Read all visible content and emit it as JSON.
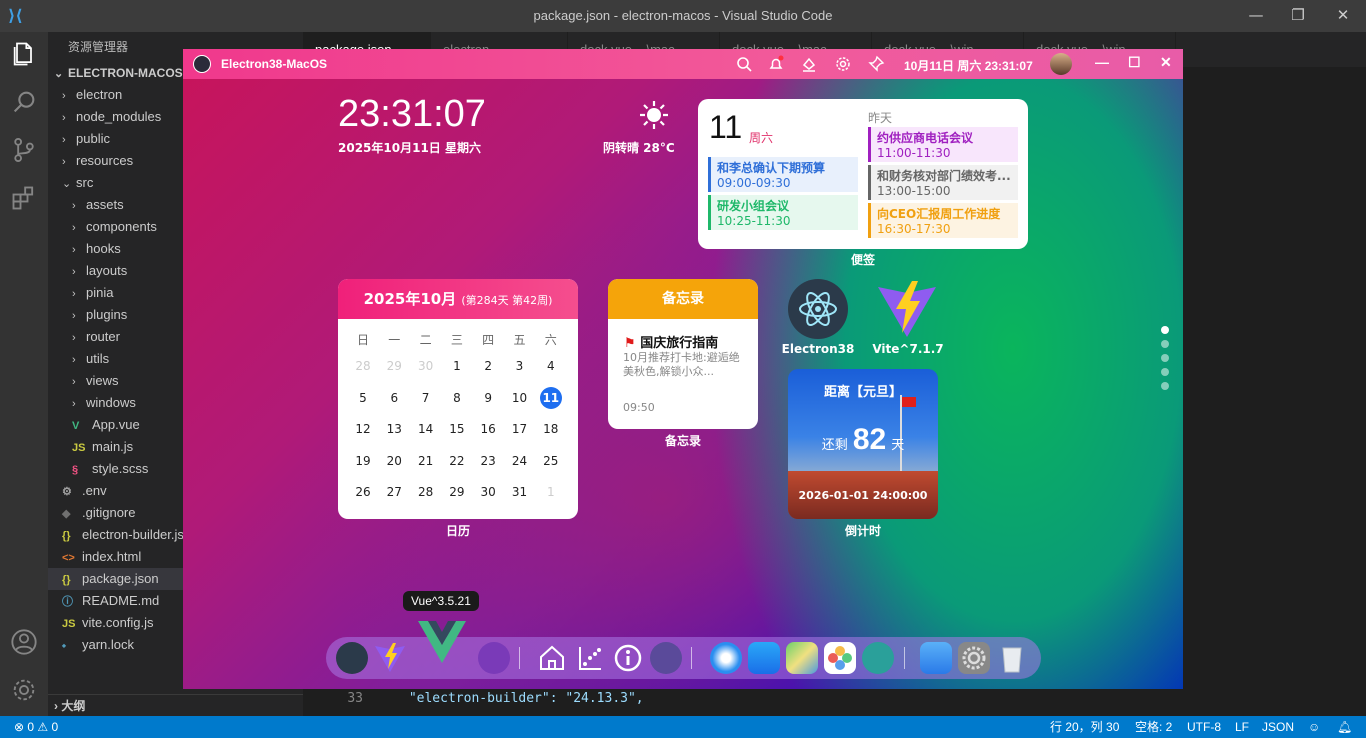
{
  "vscode": {
    "title": "package.json - electron-macos - Visual Studio Code",
    "explorer_title": "资源管理器",
    "project": "ELECTRON-MACOS",
    "tree": [
      {
        "label": "electron",
        "indent": 1,
        "chev": "›",
        "icon": ""
      },
      {
        "label": "node_modules",
        "indent": 1,
        "chev": "›",
        "icon": ""
      },
      {
        "label": "public",
        "indent": 1,
        "chev": "›",
        "icon": ""
      },
      {
        "label": "resources",
        "indent": 1,
        "chev": "›",
        "icon": ""
      },
      {
        "label": "src",
        "indent": 1,
        "chev": "⌄",
        "icon": ""
      },
      {
        "label": "assets",
        "indent": 2,
        "chev": "›",
        "icon": ""
      },
      {
        "label": "components",
        "indent": 2,
        "chev": "›",
        "icon": ""
      },
      {
        "label": "hooks",
        "indent": 2,
        "chev": "›",
        "icon": ""
      },
      {
        "label": "layouts",
        "indent": 2,
        "chev": "›",
        "icon": ""
      },
      {
        "label": "pinia",
        "indent": 2,
        "chev": "›",
        "icon": ""
      },
      {
        "label": "plugins",
        "indent": 2,
        "chev": "›",
        "icon": ""
      },
      {
        "label": "router",
        "indent": 2,
        "chev": "›",
        "icon": ""
      },
      {
        "label": "utils",
        "indent": 2,
        "chev": "›",
        "icon": ""
      },
      {
        "label": "views",
        "indent": 2,
        "chev": "›",
        "icon": ""
      },
      {
        "label": "windows",
        "indent": 2,
        "chev": "›",
        "icon": ""
      },
      {
        "label": "App.vue",
        "indent": 2,
        "chev": "",
        "icon": "V"
      },
      {
        "label": "main.js",
        "indent": 2,
        "chev": "",
        "icon": "JS"
      },
      {
        "label": "style.scss",
        "indent": 2,
        "chev": "",
        "icon": "§"
      },
      {
        "label": ".env",
        "indent": 1,
        "chev": "",
        "icon": "⚙"
      },
      {
        "label": ".gitignore",
        "indent": 1,
        "chev": "",
        "icon": "◆"
      },
      {
        "label": "electron-builder.js",
        "indent": 1,
        "chev": "",
        "icon": "{}"
      },
      {
        "label": "index.html",
        "indent": 1,
        "chev": "",
        "icon": "<>"
      },
      {
        "label": "package.json",
        "indent": 1,
        "chev": "",
        "icon": "{}",
        "selected": true
      },
      {
        "label": "README.md",
        "indent": 1,
        "chev": "",
        "icon": "ⓘ"
      },
      {
        "label": "vite.config.js",
        "indent": 1,
        "chev": "",
        "icon": "JS"
      },
      {
        "label": "yarn.lock",
        "indent": 1,
        "chev": "",
        "icon": "⬩"
      }
    ],
    "outline_label": "大纲",
    "tabs": [
      "package.json",
      "electron-builder.json",
      "dock.vue ...\\mac",
      "dock.vue ...\\mac",
      "dock.vue ...\\win",
      "dock.vue ...\\win"
    ],
    "code_line_no": "33",
    "code_line": "\"electron-builder\": \"24.13.3\",",
    "status": {
      "errors": "0",
      "warnings": "0",
      "position": "行 20，列 30",
      "spaces": "空格: 2",
      "encoding": "UTF-8",
      "eol": "LF",
      "language": "JSON"
    }
  },
  "app": {
    "title": "Electron38-MacOS",
    "datetime": "10月11日 周六 23:31:07",
    "clock": "23:31:07",
    "date": "2025年10月11日 星期六",
    "weather": "阴转晴 28°C",
    "notes_widget": {
      "day": "11",
      "weekday": "周六",
      "yesterday": "昨天",
      "label": "便签",
      "left": [
        {
          "title": "和李总确认下期预算",
          "time": "09:00-09:30",
          "color": "#2f6fd8",
          "bg": "#e8f0fc"
        },
        {
          "title": "研发小组会议",
          "time": "10:25-11:30",
          "color": "#1fb86a",
          "bg": "#e6f8ee"
        }
      ],
      "right": [
        {
          "title": "约供应商电话会议",
          "time": "11:00-11:30",
          "color": "#a020c0",
          "bg": "#f8e6fc"
        },
        {
          "title": "和财务核对部门绩效考...",
          "time": "13:00-15:00",
          "color": "#666666",
          "bg": "#f1f1f1"
        },
        {
          "title": "向CEO汇报周工作进度",
          "time": "16:30-17:30",
          "color": "#f0a010",
          "bg": "#fdf3e2"
        }
      ]
    },
    "calendar": {
      "header": "2025年10月",
      "sub": "(第284天 第42周)",
      "label": "日历",
      "weekdays": [
        "日",
        "一",
        "二",
        "三",
        "四",
        "五",
        "六"
      ],
      "days": [
        [
          "28",
          "29",
          "30",
          "1",
          "2",
          "3",
          "4"
        ],
        [
          "5",
          "6",
          "7",
          "8",
          "9",
          "10",
          "11"
        ],
        [
          "12",
          "13",
          "14",
          "15",
          "16",
          "17",
          "18"
        ],
        [
          "19",
          "20",
          "21",
          "22",
          "23",
          "24",
          "25"
        ],
        [
          "26",
          "27",
          "28",
          "29",
          "30",
          "31",
          "1"
        ]
      ],
      "today": "11"
    },
    "memo": {
      "header": "备忘录",
      "title": "国庆旅行指南",
      "body": "10月推荐打卡地:避逅绝美秋色,解锁小众...",
      "time": "09:50",
      "label": "备忘录"
    },
    "apps": [
      {
        "label": "Electron38"
      },
      {
        "label": "Vite^7.1.7"
      }
    ],
    "countdown": {
      "title": "距离【元旦】",
      "prefix": "还剩",
      "days": "82",
      "suffix": "天",
      "target": "2026-01-01 24:00:00",
      "label": "倒计时"
    },
    "tooltip": "Vue^3.5.21"
  }
}
